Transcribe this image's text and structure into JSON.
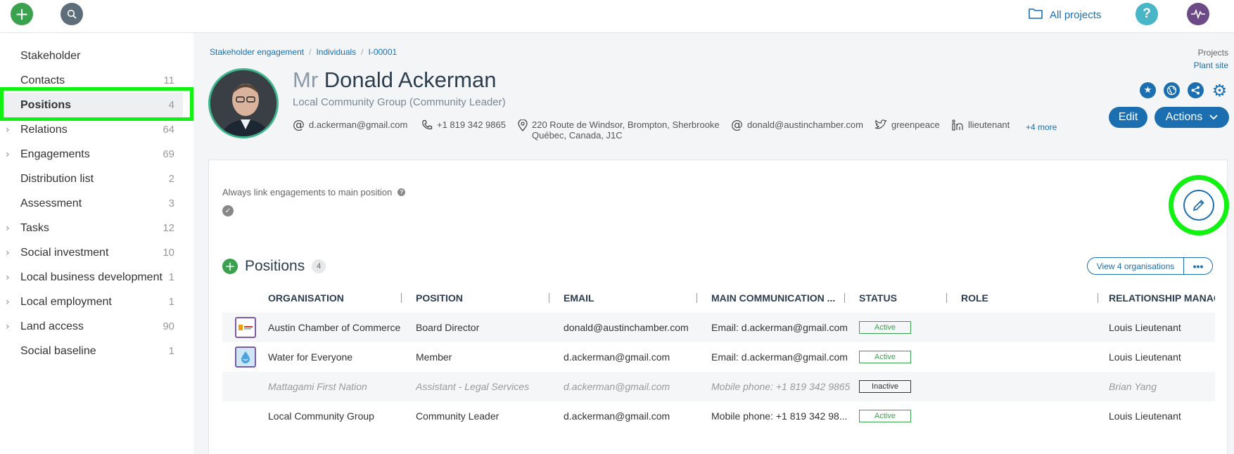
{
  "topbar": {
    "all_projects": "All projects",
    "help": "?"
  },
  "sidebar": {
    "items": [
      {
        "label": "Stakeholder",
        "count": "",
        "expandable": false
      },
      {
        "label": "Contacts",
        "count": "11",
        "expandable": false
      },
      {
        "label": "Positions",
        "count": "4",
        "expandable": false,
        "active": true
      },
      {
        "label": "Relations",
        "count": "64",
        "expandable": true
      },
      {
        "label": "Engagements",
        "count": "69",
        "expandable": true
      },
      {
        "label": "Distribution list",
        "count": "2",
        "expandable": false
      },
      {
        "label": "Assessment",
        "count": "3",
        "expandable": false
      },
      {
        "label": "Tasks",
        "count": "12",
        "expandable": true
      },
      {
        "label": "Social investment",
        "count": "10",
        "expandable": true
      },
      {
        "label": "Local business development",
        "count": "1",
        "expandable": true
      },
      {
        "label": "Local employment",
        "count": "1",
        "expandable": true
      },
      {
        "label": "Land access",
        "count": "90",
        "expandable": true
      },
      {
        "label": "Social baseline",
        "count": "1",
        "expandable": false
      }
    ]
  },
  "breadcrumb": [
    "Stakeholder engagement",
    "Individuals",
    "I-00001"
  ],
  "projects_meta": {
    "label": "Projects",
    "value": "Plant site"
  },
  "profile": {
    "title": "Mr",
    "name": "Donald Ackerman",
    "subtitle": "Local Community Group (Community Leader)",
    "email": "d.ackerman@gmail.com",
    "phone": "+1 819 342 9865",
    "address_line1": "220 Route de Windsor, Brompton, Sherbrooke",
    "address_line2": "Québec, Canada, J1C",
    "email2": "donald@austinchamber.com",
    "twitter": "greenpeace",
    "linkedin": "llieutenant",
    "more": "+4 more"
  },
  "buttons": {
    "edit": "Edit",
    "actions": "Actions"
  },
  "card": {
    "link_label": "Always link engagements to main position",
    "positions_title": "Positions",
    "positions_count": "4",
    "view_orgs": "View 4 organisations",
    "more": "•••"
  },
  "table": {
    "columns": [
      "ORGANISATION",
      "POSITION",
      "EMAIL",
      "MAIN COMMUNICATION ...",
      "STATUS",
      "ROLE",
      "RELATIONSHIP MANAGER"
    ],
    "rows": [
      {
        "org": "Austin Chamber of Commerce",
        "position": "Board Director",
        "email": "donald@austinchamber.com",
        "comm": "Email: d.ackerman@gmail.com",
        "status": "Active",
        "role": "",
        "manager": "Louis Lieutenant"
      },
      {
        "org": "Water for Everyone",
        "position": "Member",
        "email": "d.ackerman@gmail.com",
        "comm": "Email: d.ackerman@gmail.com",
        "status": "Active",
        "role": "",
        "manager": "Louis Lieutenant"
      },
      {
        "org": "Mattagami First Nation",
        "position": "Assistant - Legal Services",
        "email": "d.ackerman@gmail.com",
        "comm": "Mobile phone: +1 819 342 9865",
        "status": "Inactive",
        "role": "",
        "manager": "Brian Yang"
      },
      {
        "org": "Local Community Group",
        "position": "Community Leader",
        "email": "d.ackerman@gmail.com",
        "comm": "Mobile phone: +1 819 342 98...",
        "status": "Active",
        "role": "",
        "manager": "Louis Lieutenant"
      }
    ]
  },
  "colors": {
    "brand": "#1b6fb0",
    "add": "#3aa24f",
    "highlight": "#12f212"
  }
}
